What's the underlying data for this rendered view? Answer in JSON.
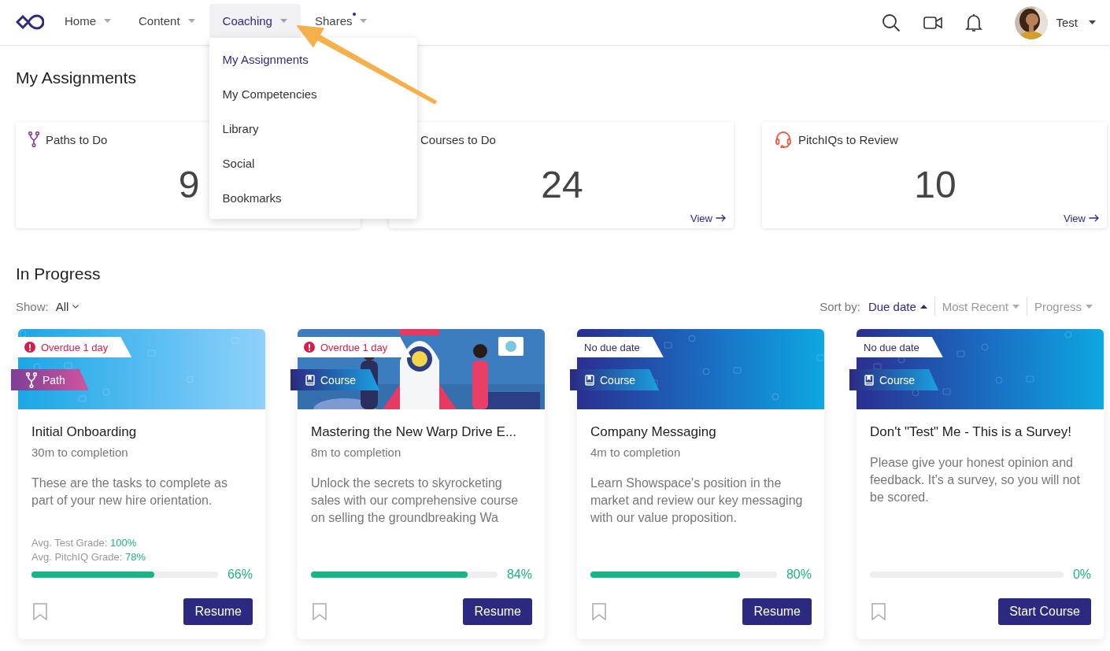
{
  "nav": {
    "items": [
      {
        "label": "Home",
        "selected": false,
        "dot": false
      },
      {
        "label": "Content",
        "selected": false,
        "dot": false
      },
      {
        "label": "Coaching",
        "selected": true,
        "dot": false
      },
      {
        "label": "Shares",
        "selected": false,
        "dot": true
      }
    ]
  },
  "user": {
    "name": "Test"
  },
  "menu": {
    "items": [
      {
        "label": "My Assignments",
        "selected": true
      },
      {
        "label": "My Competencies",
        "selected": false
      },
      {
        "label": "Library",
        "selected": false
      },
      {
        "label": "Social",
        "selected": false
      },
      {
        "label": "Bookmarks",
        "selected": false
      }
    ]
  },
  "assignments": {
    "title": "My Assignments",
    "cards": [
      {
        "kind": "path",
        "title": "Paths to Do",
        "count": "9"
      },
      {
        "kind": "course",
        "title": "Courses to Do",
        "count": "24",
        "link": "View"
      },
      {
        "kind": "pitchiq",
        "title": "PitchIQs to Review",
        "count": "10",
        "link": "View"
      }
    ]
  },
  "in_progress": {
    "title": "In Progress",
    "show": {
      "label": "Show:",
      "value": "All"
    },
    "sort": {
      "label": "Sort by:",
      "options": [
        {
          "label": "Due date",
          "selected": true
        },
        {
          "label": "Most Recent",
          "selected": false
        },
        {
          "label": "Progress",
          "selected": false
        }
      ]
    },
    "cards": [
      {
        "due": {
          "kind": "overdue",
          "text": "Overdue 1 day"
        },
        "type": {
          "kind": "path",
          "label": "Path"
        },
        "title": "Initial Onboarding",
        "duration": "30m to completion",
        "description": "These are the tasks to complete as part of your new hire orientation.",
        "grades": [
          {
            "label": "Avg. Test Grade:",
            "value": "100%"
          },
          {
            "label": "Avg. PitchIQ Grade:",
            "value": "78%"
          }
        ],
        "level": 0.66,
        "percent": "66%",
        "bookmarked": false,
        "button": "Resume"
      },
      {
        "due": {
          "kind": "overdue",
          "text": "Overdue 1 day"
        },
        "type": {
          "kind": "course",
          "label": "Course"
        },
        "title": "Mastering the New Warp Drive E...",
        "duration": "8m to completion",
        "description": "Unlock the secrets to skyrocketing sales with our comprehensive course on selling the groundbreaking Wa",
        "level": 0.84,
        "percent": "84%",
        "bookmarked": false,
        "button": "Resume"
      },
      {
        "due": {
          "kind": "none",
          "text": "No due date"
        },
        "type": {
          "kind": "course",
          "label": "Course"
        },
        "title": "Company Messaging",
        "duration": "4m to completion",
        "description": "Learn Showspace's position in the market and review our key messaging with our value proposition.",
        "level": 0.8,
        "percent": "80%",
        "bookmarked": false,
        "button": "Resume"
      },
      {
        "due": {
          "kind": "none",
          "text": "No due date"
        },
        "type": {
          "kind": "course",
          "label": "Course"
        },
        "title": "Don't \"Test\" Me - This is a Survey!",
        "description": "Please give your honest opinion and feedback. It's a survey, so you will not be scored.",
        "percent": "0%",
        "bookmarked": false,
        "button": "Start Course"
      }
    ]
  }
}
